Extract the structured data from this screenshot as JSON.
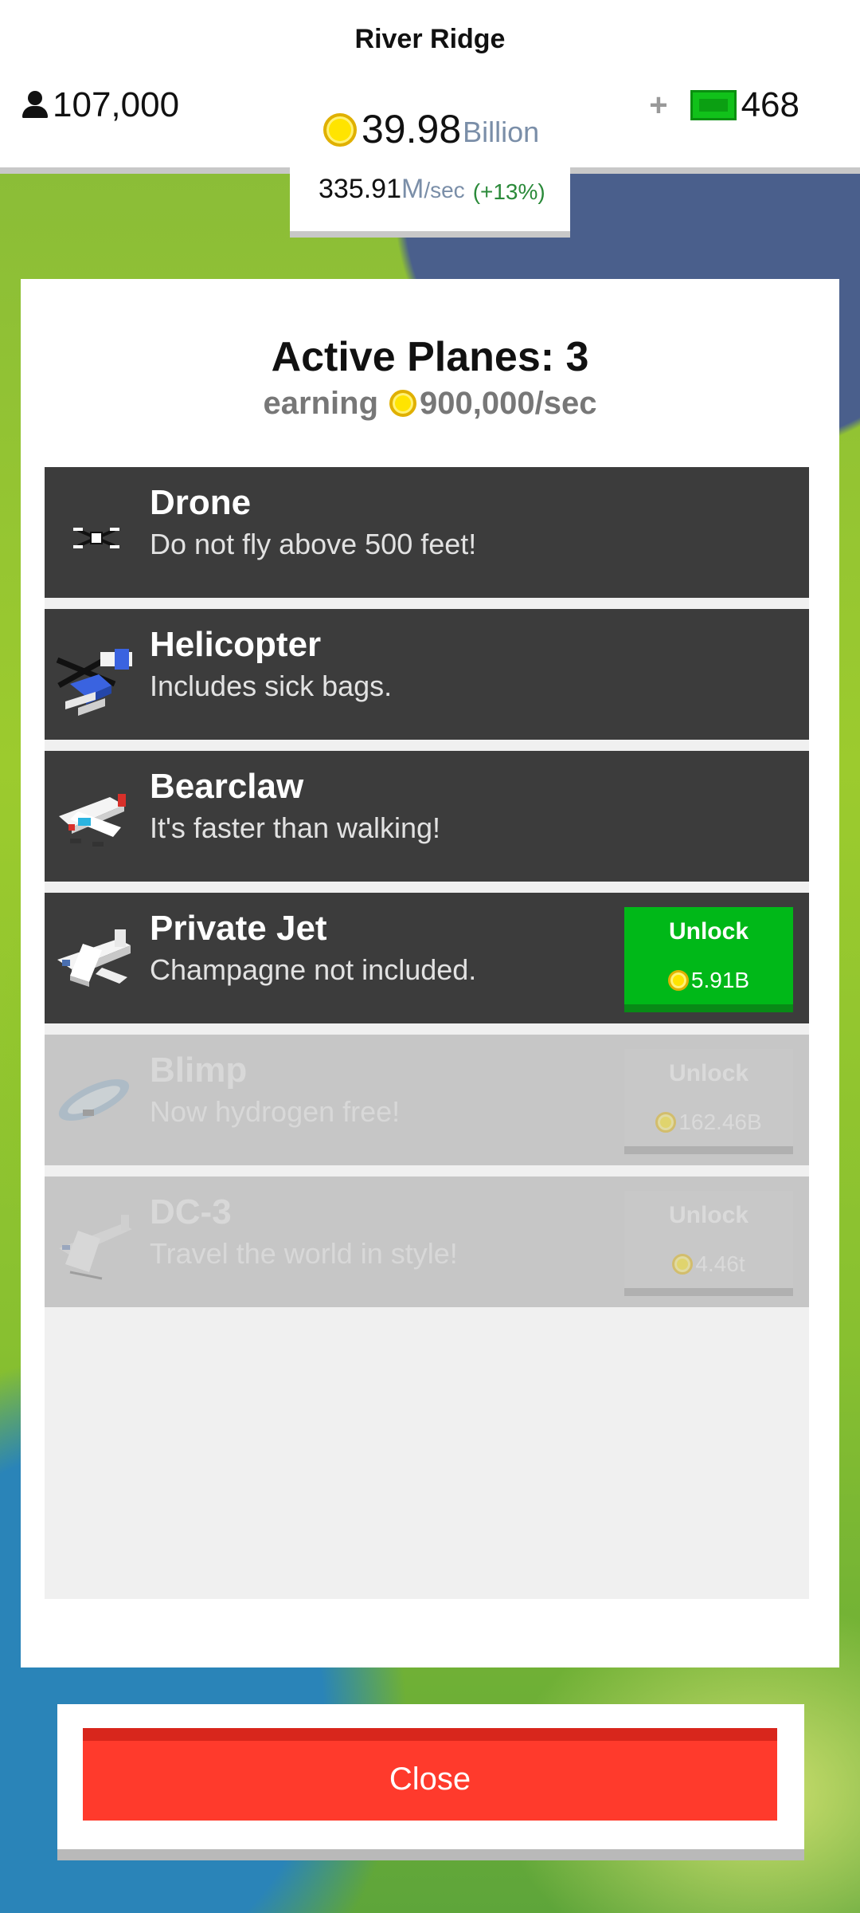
{
  "header": {
    "city_name": "River Ridge",
    "population": "107,000",
    "gems_plus": "+",
    "gems": "468",
    "cash_value": "39.98",
    "cash_unit": "Billion",
    "rate_value": "335.91",
    "rate_unit_big": "M",
    "rate_unit_small": "/sec",
    "rate_bonus": "(+13%)"
  },
  "modal": {
    "title": "Active Planes: 3",
    "earning_label": "earning",
    "earning_value": "900,000/sec",
    "planes": [
      {
        "name": "Drone",
        "description": "Do not fly above 500 feet!",
        "icon": "drone-icon",
        "state": "owned"
      },
      {
        "name": "Helicopter",
        "description": "Includes sick bags.",
        "icon": "helicopter-icon",
        "state": "owned"
      },
      {
        "name": "Bearclaw",
        "description": "It's faster than walking!",
        "icon": "bearclaw-plane-icon",
        "state": "owned"
      },
      {
        "name": "Private Jet",
        "description": "Champagne not included.",
        "icon": "private-jet-icon",
        "state": "unlockable",
        "unlock_label": "Unlock",
        "price": "5.91B"
      },
      {
        "name": "Blimp",
        "description": "Now hydrogen free!",
        "icon": "blimp-icon",
        "state": "locked",
        "unlock_label": "Unlock",
        "price": "162.46B"
      },
      {
        "name": "DC-3",
        "description": "Travel the world in style!",
        "icon": "dc3-plane-icon",
        "state": "locked",
        "unlock_label": "Unlock",
        "price": "4.46t"
      }
    ],
    "close_label": "Close"
  },
  "colors": {
    "unlock_green": "#00b818",
    "close_red": "#ff3a2c",
    "row_dark": "#3c3c3c",
    "row_locked": "#c6c6c6",
    "coin_yellow": "#ffe400",
    "gem_green": "#11c11a"
  }
}
